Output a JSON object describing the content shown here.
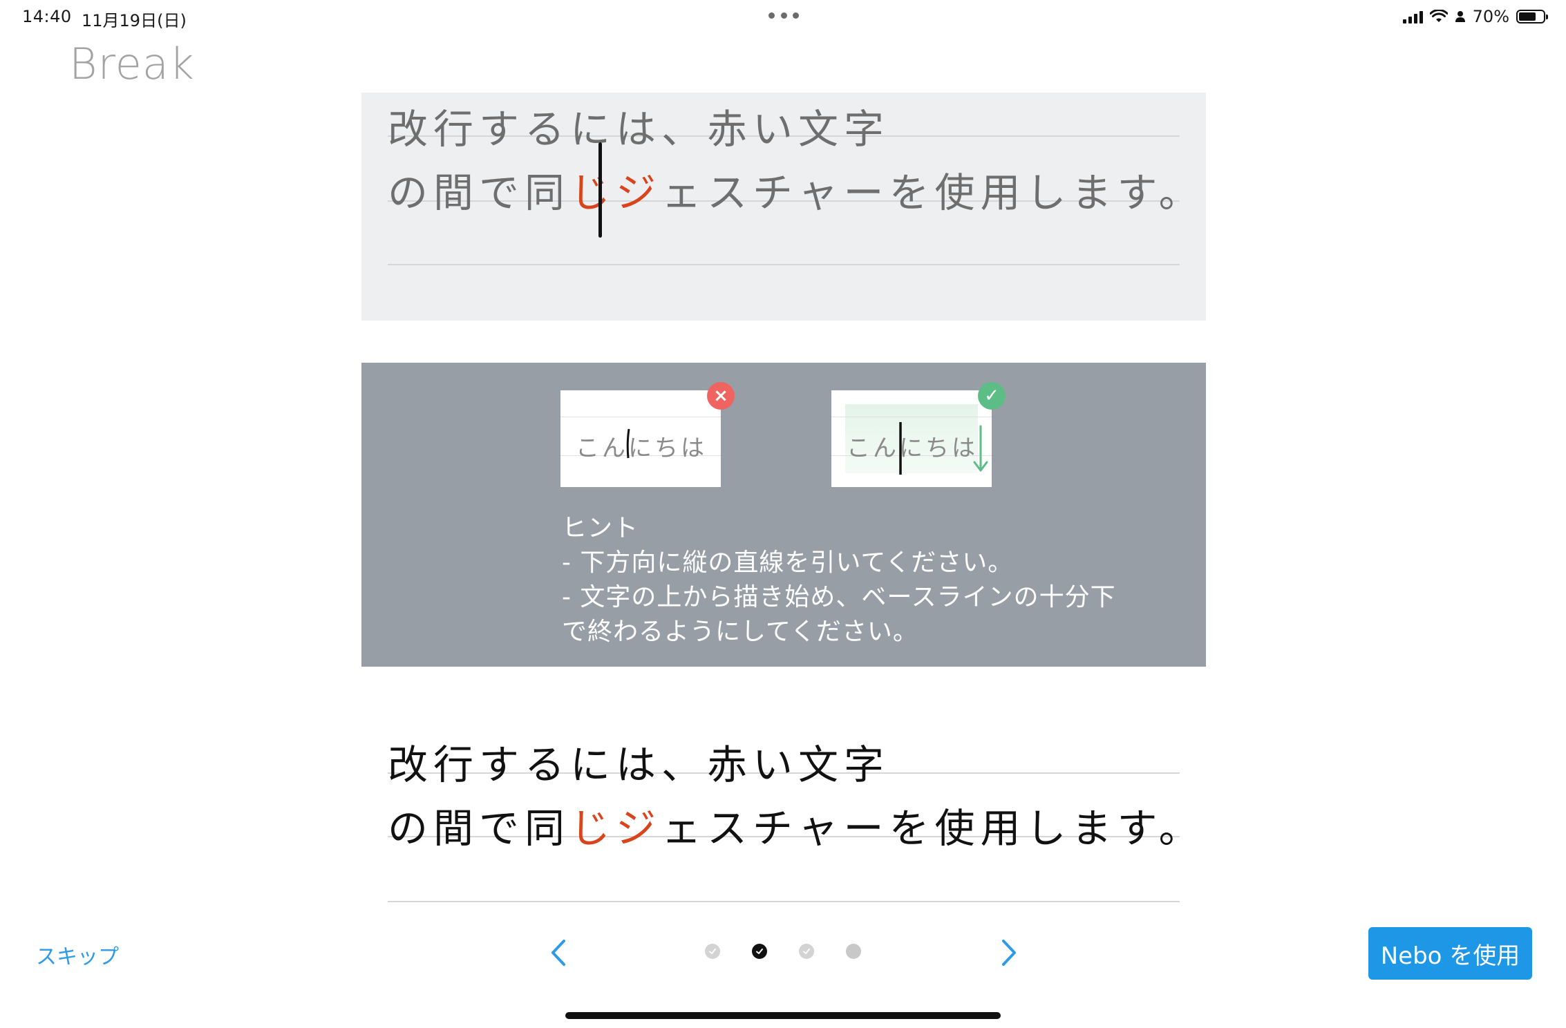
{
  "status_bar": {
    "time": "14:40",
    "date": "11月19日(日)",
    "battery": "70%",
    "battery_level": 0.7
  },
  "header": {
    "title": "Break"
  },
  "demo_top": {
    "line1": "改行するには、赤い文字",
    "line2_pre": "の間で同",
    "line2_red1": "じ",
    "line2_red2": "ジ",
    "line2_post": "ェスチャーを使用します。"
  },
  "hint": {
    "bad_example": "こんにちは",
    "good_example": "こんにちは",
    "title": "ヒント",
    "item1": "- 下方向に縦の直線を引いてください。",
    "item2": "- 文字の上から描き始め、ベースラインの十分下",
    "item2_cont": "で終わるようにしてください。",
    "bad_icon": "×",
    "good_icon": "✓",
    "bad_color": "#ef6461",
    "good_color": "#5cbe86"
  },
  "demo_bottom": {
    "line1": "改行するには、赤い文字",
    "line2_pre": "の間で同",
    "line2_red1": "じ",
    "line2_red2": "ジ",
    "line2_post": "ェスチャーを使用します。"
  },
  "nav": {
    "skip_label": "スキップ",
    "cta_label": "Nebo を使用",
    "accent_color": "#1d97e6",
    "pages": [
      {
        "state": "done"
      },
      {
        "state": "current"
      },
      {
        "state": "done"
      },
      {
        "state": "upcoming"
      }
    ]
  }
}
